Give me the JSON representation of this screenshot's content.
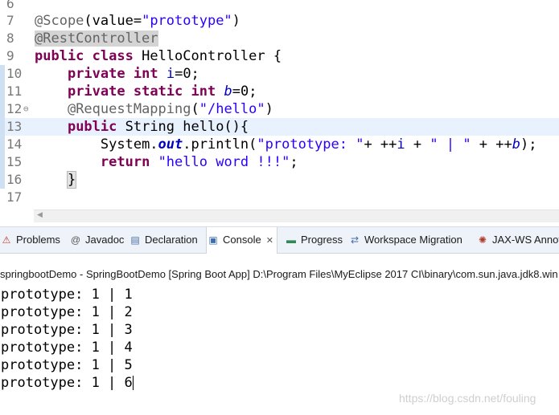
{
  "editor": {
    "lines": [
      {
        "num": "6"
      },
      {
        "num": "7",
        "annotation": "@Scope",
        "t1": "(value=",
        "str": "\"prototype\"",
        "t2": ")"
      },
      {
        "num": "8",
        "annotation": "@RestController"
      },
      {
        "num": "9",
        "kw1": "public",
        "kw2": "class",
        "text": " HelloController {"
      },
      {
        "num": "10",
        "kw1": "private",
        "kw2": "int",
        "field": "i",
        "text": "=0;"
      },
      {
        "num": "11",
        "kw1": "private",
        "kw2": "static",
        "kw3": "int",
        "field": "b",
        "text": "=0;"
      },
      {
        "num": "12",
        "annotation": "@RequestMapping",
        "t1": "(",
        "str": "\"/hello\"",
        "t2": ")"
      },
      {
        "num": "13",
        "kw1": "public",
        "text": " String hello(){"
      },
      {
        "num": "14",
        "t1": "System.",
        "sfield": "out",
        "t2": ".println(",
        "s1": "\"prototype: \"",
        "t3": "+ ++",
        "f1": "i",
        "t4": " + ",
        "s2": "\" | \"",
        "t5": " + ++",
        "f2": "b",
        "t6": ");"
      },
      {
        "num": "15",
        "kw1": "return",
        "str": "\"hello word !!!\"",
        "t1": ";"
      },
      {
        "num": "16",
        "text": "}"
      },
      {
        "num": "17"
      }
    ]
  },
  "tabs": [
    {
      "label": "Problems",
      "icon": "problems-icon",
      "glyph": "⚠",
      "color": "#c0392b"
    },
    {
      "label": "Javadoc",
      "icon": "javadoc-icon",
      "glyph": "@",
      "color": "#555555"
    },
    {
      "label": "Declaration",
      "icon": "declaration-icon",
      "glyph": "▤",
      "color": "#4a6da7"
    },
    {
      "label": "Console",
      "icon": "console-icon",
      "glyph": "▣",
      "color": "#3b6fb0",
      "active": true
    },
    {
      "label": "Progress",
      "icon": "progress-icon",
      "glyph": "▬",
      "color": "#2e8b57"
    },
    {
      "label": "Workspace Migration",
      "icon": "migration-icon",
      "glyph": "⇄",
      "color": "#4a6da7"
    },
    {
      "label": "JAX-WS Annot",
      "icon": "jaxws-icon",
      "glyph": "✺",
      "color": "#b03a2e"
    }
  ],
  "console": {
    "title": "springbootDemo - SpringBootDemo [Spring Boot App] D:\\Program Files\\MyEclipse 2017 CI\\binary\\com.sun.java.jdk8.win",
    "output": [
      "prototype: 1 | 1",
      "prototype: 1 | 2",
      "prototype: 1 | 3",
      "prototype: 1 | 4",
      "prototype: 1 | 5",
      "prototype: 1 | 6"
    ]
  },
  "watermark": "https://blog.csdn.net/fouling"
}
